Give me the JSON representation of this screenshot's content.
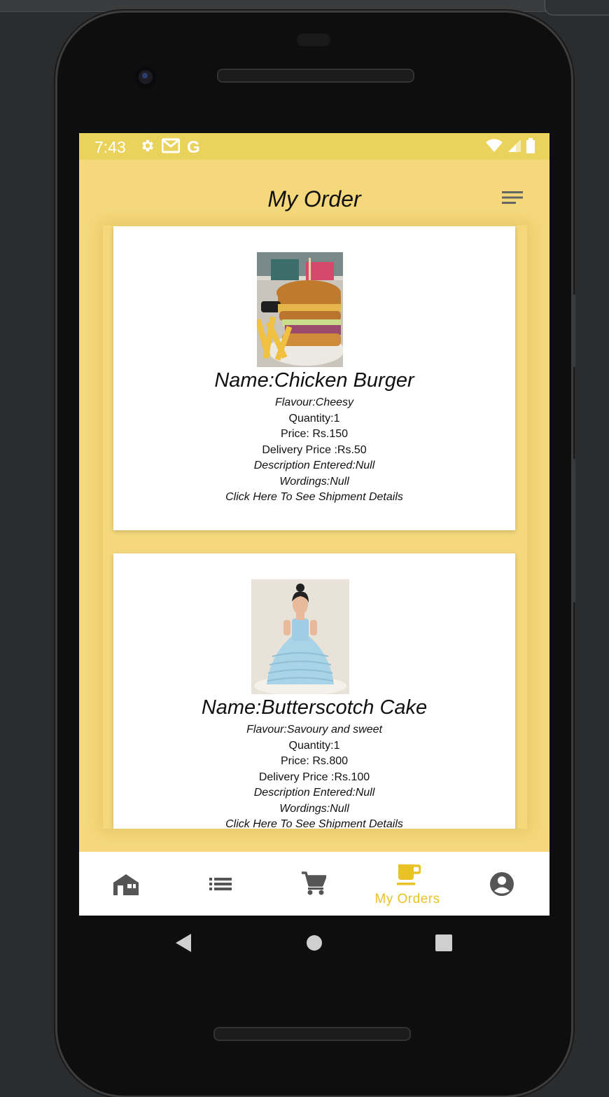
{
  "status_bar": {
    "time": "7:43",
    "left_icons": [
      "gear-icon",
      "gmail-icon",
      "google-g-icon"
    ],
    "google_g": "G",
    "right_icons": [
      "wifi-icon",
      "signal-icon",
      "battery-icon"
    ]
  },
  "header": {
    "title": "My Order",
    "menu_icon": "sort-menu-icon"
  },
  "orders": [
    {
      "name": "Name:Chicken Burger",
      "flavour": "Flavour:Cheesy",
      "quantity": "Quantity:1",
      "price": "Price: Rs.150",
      "delivery_price": "Delivery Price :Rs.50",
      "description": "Description Entered:Null",
      "wordings": "Wordings:Null",
      "shipment_link": "Click Here To See Shipment Details"
    },
    {
      "name": "Name:Butterscotch Cake",
      "flavour": "Flavour:Savoury and sweet",
      "quantity": "Quantity:1",
      "price": "Price: Rs.800",
      "delivery_price": "Delivery Price :Rs.100",
      "description": "Description Entered:Null",
      "wordings": "Wordings:Null",
      "shipment_link": "Click Here To See Shipment Details"
    }
  ],
  "bottom_nav": {
    "items": [
      {
        "icon": "home-icon"
      },
      {
        "icon": "list-icon"
      },
      {
        "icon": "cart-icon"
      },
      {
        "icon": "cup-icon",
        "label": "My Orders"
      },
      {
        "icon": "account-icon"
      }
    ],
    "active_color": "#e9c225",
    "inactive_color": "#555555"
  },
  "colors": {
    "background": "#f5d87c",
    "status_bar": "#e9d35c"
  }
}
